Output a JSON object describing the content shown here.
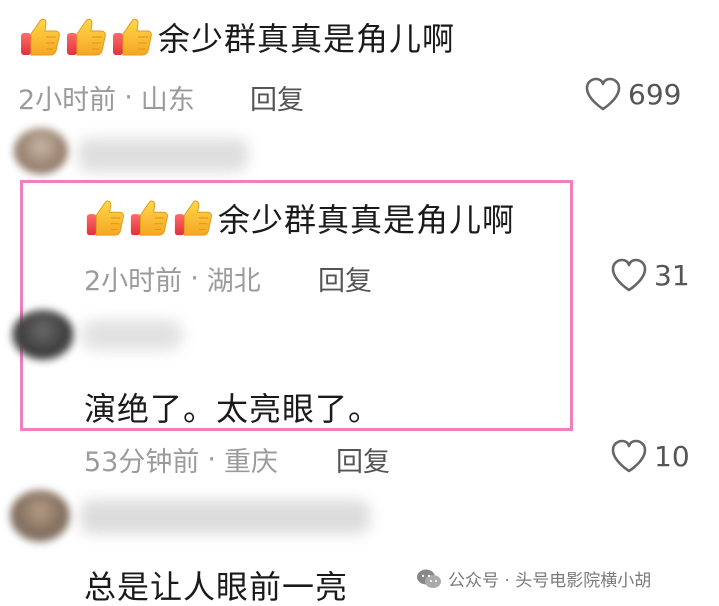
{
  "comments": [
    {
      "emoji": [
        "thumbs-up",
        "thumbs-up",
        "thumbs-up"
      ],
      "text": "余少群真真是角儿啊",
      "time": "2小时前",
      "separator": "·",
      "location": "山东",
      "reply_label": "回复",
      "likes": "699"
    },
    {
      "emoji": [
        "thumbs-up",
        "thumbs-up",
        "thumbs-up"
      ],
      "text": "余少群真真是角儿啊",
      "time": "2小时前",
      "separator": "·",
      "location": "湖北",
      "reply_label": "回复",
      "likes": "31"
    },
    {
      "text": "演绝了。太亮眼了。",
      "time": "53分钟前",
      "separator": "·",
      "location": "重庆",
      "reply_label": "回复",
      "likes": "10"
    },
    {
      "text": "总是让人眼前一亮"
    }
  ],
  "watermark": {
    "text": "公众号 · 头号电影院横小胡",
    "icon": "wechat-icon"
  },
  "colors": {
    "highlight_border": "#ef7fbd",
    "meta_gray": "#9b9b9b",
    "text": "#1a1a1a"
  }
}
